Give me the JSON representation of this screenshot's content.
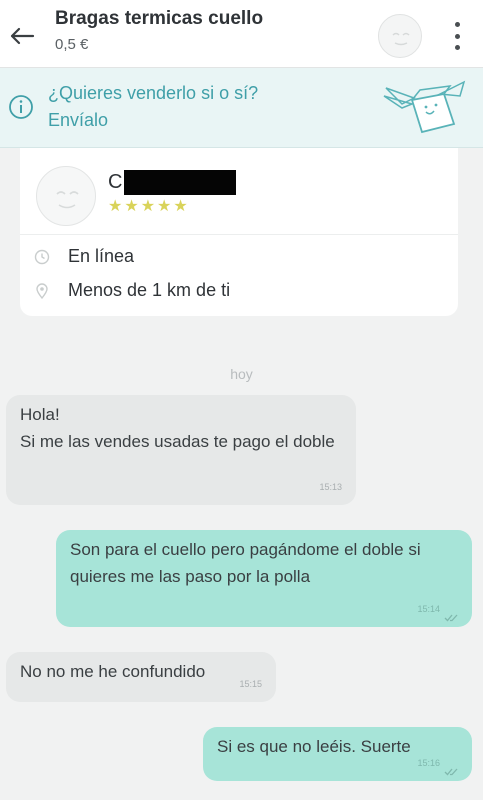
{
  "header": {
    "title": "Bragas termicas cuello",
    "price": "0,5 €"
  },
  "promo": {
    "text": "¿Quieres venderlo si o sí? Envíalo"
  },
  "seller": {
    "name_visible": "C",
    "rating": "★★★★★",
    "status": "En línea",
    "distance": "Menos de 1 km de ti"
  },
  "chat": {
    "date_separator": "hoy",
    "messages": [
      {
        "direction": "in",
        "text": "Hola!\nSi me las vendes usadas te pago el doble",
        "time": "15:13"
      },
      {
        "direction": "out",
        "text": "Son para el cuello pero pagándome el doble si quieres me las paso por la polla",
        "time": "15:14"
      },
      {
        "direction": "in",
        "text": "No no me he confundido",
        "time": "15:15"
      },
      {
        "direction": "out",
        "text": "Si es que no leéis. Suerte",
        "time": "15:16"
      }
    ]
  },
  "colors": {
    "accent": "#3f9fa8",
    "outgoing_bubble": "#a7e4d8",
    "incoming_bubble": "#e6e8e8",
    "star": "#d9d35a"
  }
}
